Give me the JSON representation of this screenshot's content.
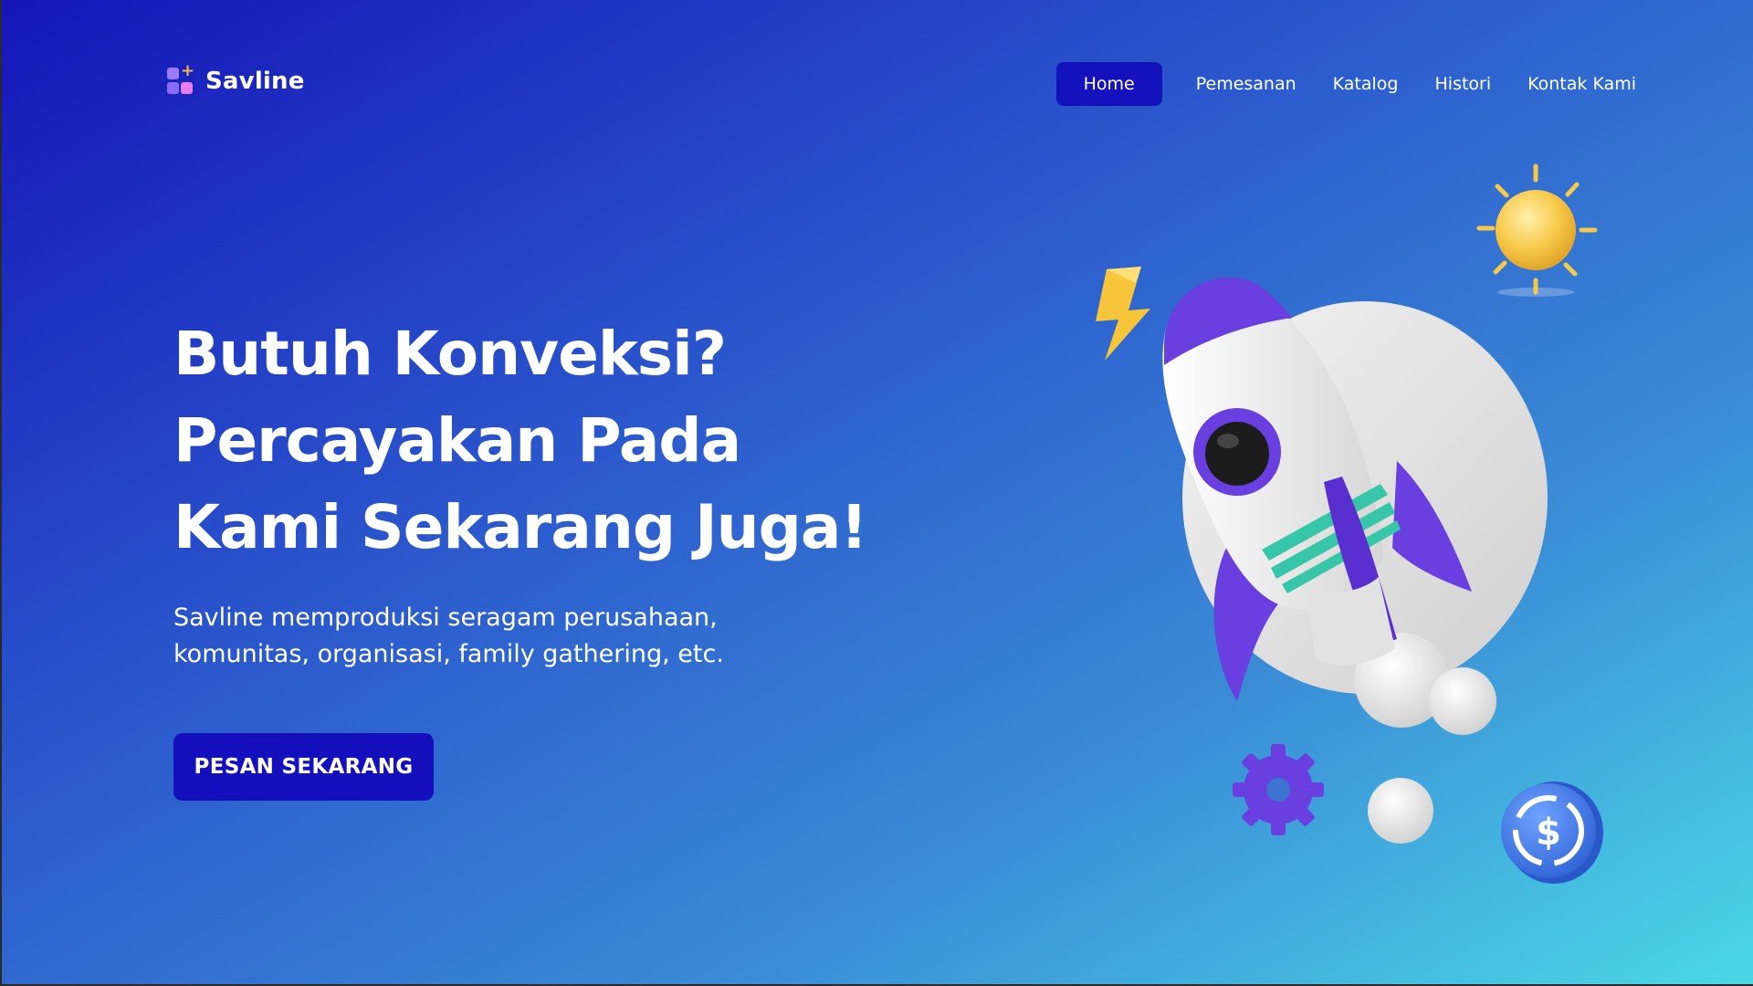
{
  "brand": {
    "name": "Savline",
    "icon": "grid-plus-logo-icon"
  },
  "nav": {
    "items": [
      {
        "label": "Home",
        "active": true
      },
      {
        "label": "Pemesanan",
        "active": false
      },
      {
        "label": "Katalog",
        "active": false
      },
      {
        "label": "Histori",
        "active": false
      },
      {
        "label": "Kontak Kami",
        "active": false
      }
    ]
  },
  "hero": {
    "title_lines": [
      "Butuh Konveksi?",
      "Percayakan Pada",
      "Kami Sekarang Juga!"
    ],
    "description_lines": [
      "Savline memproduksi seragam perusahaan,",
      "komunitas, organisasi, family gathering, etc."
    ],
    "cta_label": "PESAN SEKARANG"
  },
  "illustration": {
    "icons": [
      "rocket-icon",
      "lightning-icon",
      "sun-icon",
      "gear-icon",
      "coin-dollar-icon",
      "cloud-puff-icon"
    ]
  },
  "colors": {
    "nav_active_bg": "#1412bd",
    "cta_bg": "#1510bd",
    "gradient_start": "#1515b8",
    "gradient_end": "#4bd8e6",
    "rocket_accent": "#6a3fe0",
    "rocket_stripe": "#38c6a8",
    "sun": "#f7c94a"
  }
}
